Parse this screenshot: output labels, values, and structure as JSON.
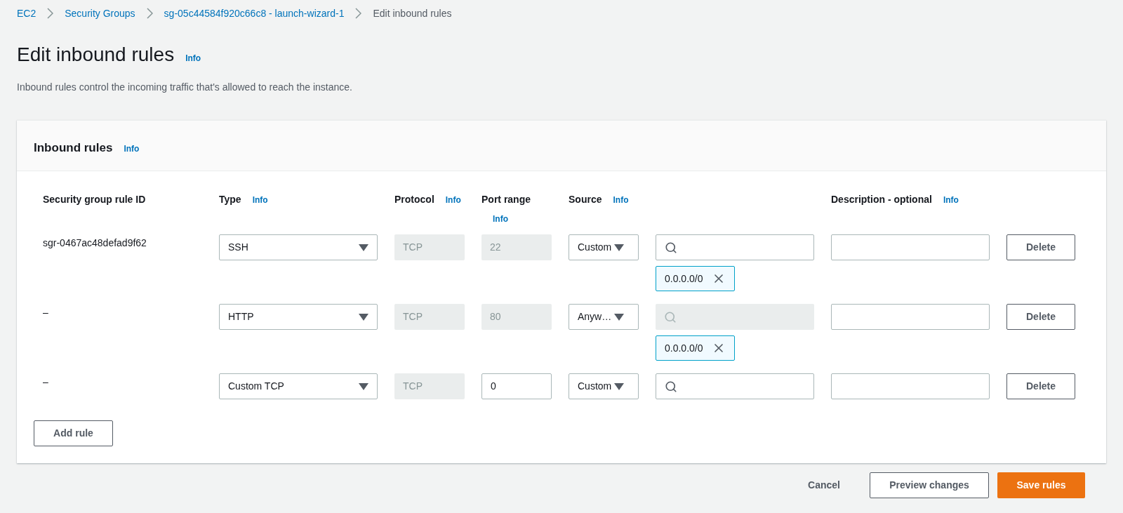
{
  "breadcrumb": [
    {
      "label": "EC2",
      "current": false
    },
    {
      "label": "Security Groups",
      "current": false
    },
    {
      "label": "sg-05c44584f920c66c8 - launch-wizard-1",
      "current": false
    },
    {
      "label": "Edit inbound rules",
      "current": true
    }
  ],
  "page": {
    "title": "Edit inbound rules",
    "info": "Info",
    "description": "Inbound rules control the incoming traffic that's allowed to reach the instance."
  },
  "panel": {
    "title": "Inbound rules",
    "info": "Info",
    "columns": [
      {
        "label": "Security group rule ID"
      },
      {
        "label": "Type",
        "info": "Info"
      },
      {
        "label": "Protocol",
        "info": "Info"
      },
      {
        "label": "Port range",
        "info": "Info"
      },
      {
        "label": "Source",
        "info": "Info"
      },
      {
        "label": "Description - optional",
        "info": "Info"
      }
    ],
    "rows": [
      {
        "rule_id": "sgr-0467ac48defad9f62",
        "type": "SSH",
        "protocol": "TCP",
        "port_range": "22",
        "port_disabled": true,
        "source": "Custom",
        "search_disabled": false,
        "cidr_tags": [
          "0.0.0.0/0"
        ],
        "delete": "Delete"
      },
      {
        "rule_id": "–",
        "type": "HTTP",
        "protocol": "TCP",
        "port_range": "80",
        "port_disabled": true,
        "source": "Anyw…",
        "search_disabled": true,
        "cidr_tags": [
          "0.0.0.0/0"
        ],
        "delete": "Delete"
      },
      {
        "rule_id": "–",
        "type": "Custom TCP",
        "protocol": "TCP",
        "port_range": "0",
        "port_disabled": false,
        "source": "Custom",
        "search_disabled": false,
        "cidr_tags": [],
        "delete": "Delete"
      }
    ],
    "add_rule": "Add rule"
  },
  "footer": {
    "cancel": "Cancel",
    "preview": "Preview changes",
    "save": "Save rules"
  }
}
